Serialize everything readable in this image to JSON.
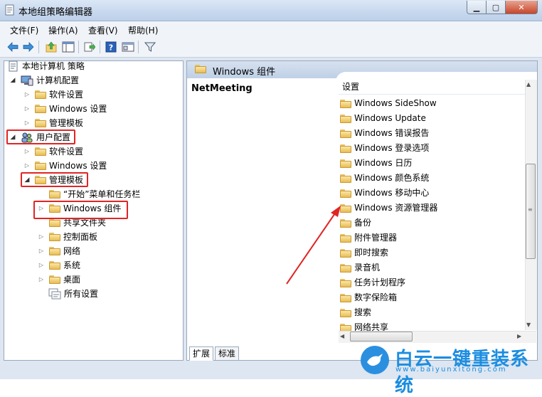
{
  "window": {
    "title": "本地组策略编辑器"
  },
  "menu": [
    "文件(F)",
    "操作(A)",
    "查看(V)",
    "帮助(H)"
  ],
  "tree": [
    {
      "label": "本地计算机 策略"
    },
    {
      "label": "计算机配置"
    },
    {
      "label": "软件设置"
    },
    {
      "label": "Windows 设置"
    },
    {
      "label": "管理模板"
    },
    {
      "label": "用户配置"
    },
    {
      "label": "软件设置"
    },
    {
      "label": "Windows 设置"
    },
    {
      "label": "管理模板"
    },
    {
      "label": "“开始”菜单和任务栏"
    },
    {
      "label": "Windows 组件"
    },
    {
      "label": "共享文件夹"
    },
    {
      "label": "控制面板"
    },
    {
      "label": "网络"
    },
    {
      "label": "系统"
    },
    {
      "label": "桌面"
    },
    {
      "label": "所有设置"
    }
  ],
  "right": {
    "header": "Windows 组件",
    "description_title": "NetMeeting",
    "column_header": "设置",
    "items": [
      "Windows SideShow",
      "Windows Update",
      "Windows 错误报告",
      "Windows 登录选项",
      "Windows 日历",
      "Windows 颜色系统",
      "Windows 移动中心",
      "Windows 资源管理器",
      "备份",
      "附件管理器",
      "即时搜索",
      "录音机",
      "任务计划程序",
      "数字保险箱",
      "搜索",
      "网络共享"
    ]
  },
  "tabs": [
    "扩展",
    "标准"
  ],
  "watermark": {
    "title": "白云一键重装系统",
    "url": "www.baiyunxitong.com"
  },
  "colors": {
    "highlight_red": "#e02525",
    "folder_yellow": "#f3d27a",
    "watermark_blue": "#1c8de0"
  }
}
